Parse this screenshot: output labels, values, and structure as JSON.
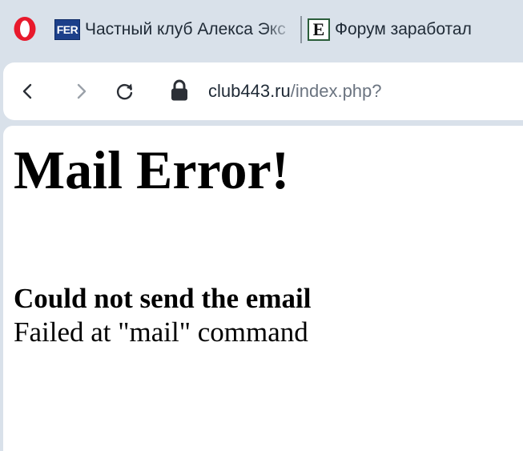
{
  "browser": {
    "logo_icon": "opera-logo-icon",
    "tabs": [
      {
        "favicon_text": "FER",
        "label": "Частный клуб Алекса Экс"
      },
      {
        "favicon_text": "E",
        "label": "Форум заработал"
      }
    ]
  },
  "addressbar": {
    "back_icon": "chevron-left-icon",
    "forward_icon": "chevron-right-icon",
    "reload_icon": "reload-icon",
    "lock_icon": "lock-icon",
    "url_host": "club443.ru",
    "url_path": "/index.php?"
  },
  "page": {
    "title": "Mail Error!",
    "subtitle": "Could not send the email",
    "detail": "Failed at \"mail\" command"
  },
  "colors": {
    "chrome_background": "#d9e1ea",
    "opera_red": "#e8192c",
    "url_path": "#6b7480"
  }
}
